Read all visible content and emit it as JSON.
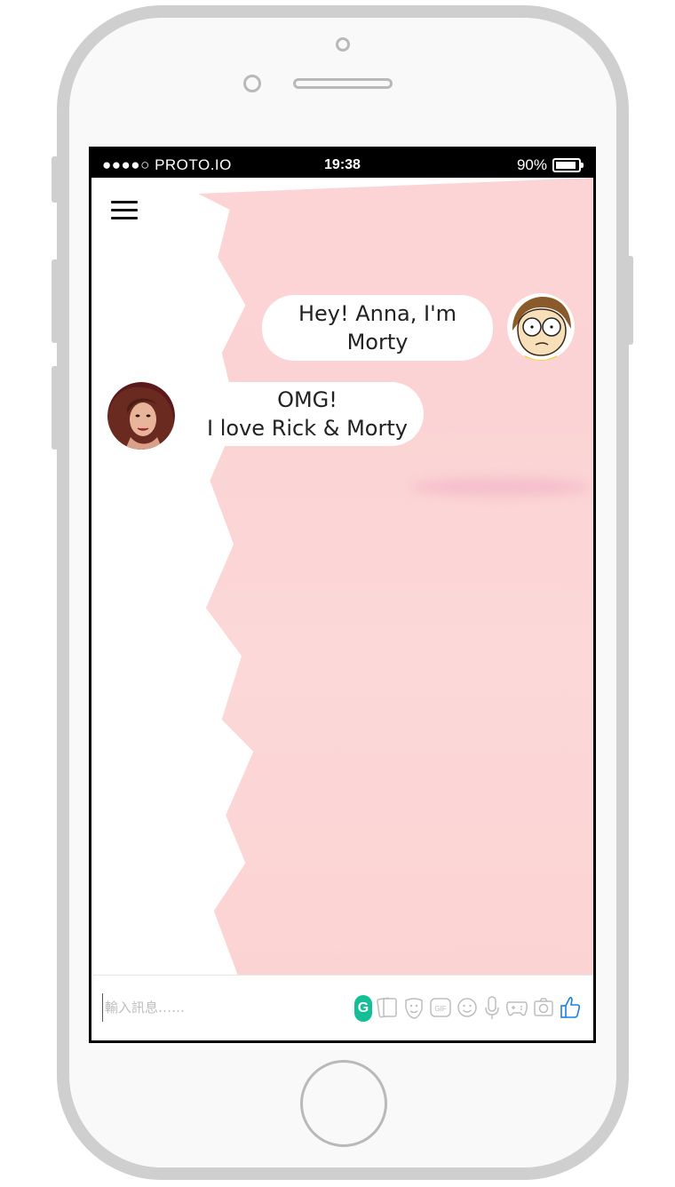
{
  "status_bar": {
    "carrier": "●●●●○ PROTO.IO",
    "time": "19:38",
    "battery": "90%"
  },
  "chat": {
    "messages": [
      {
        "sender": "Morty",
        "direction": "outgoing",
        "lines": [
          "Hey! Anna, I'm",
          "Morty"
        ]
      },
      {
        "sender": "Anna",
        "direction": "incoming",
        "lines": [
          "OMG!",
          "I love Rick & Morty"
        ]
      }
    ]
  },
  "composer": {
    "placeholder": "輸入訊息……",
    "grammarly_label": "G",
    "gif_label": "GIF",
    "icons": [
      "grammarly-icon",
      "cards-icon",
      "sticker-icon",
      "gif-icon",
      "emoji-icon",
      "microphone-icon",
      "gamepad-icon",
      "camera-icon",
      "thumbs-up-icon"
    ]
  },
  "colors": {
    "background_paint": "#fcd4d6",
    "like_blue": "#1a7fe0",
    "grammarly_green": "#14bf96",
    "tool_gray": "#bdbdbd"
  }
}
